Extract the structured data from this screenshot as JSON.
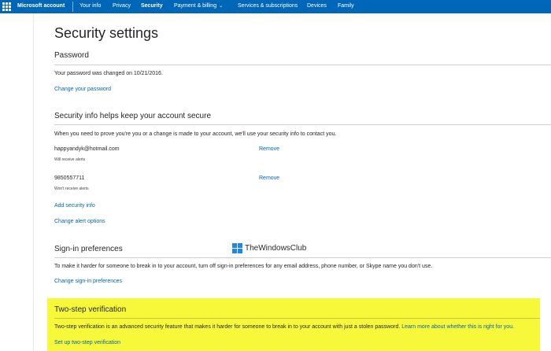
{
  "header": {
    "brand": "Microsoft account",
    "nav": [
      {
        "label": "Your info"
      },
      {
        "label": "Privacy"
      },
      {
        "label": "Security"
      },
      {
        "label": "Payment & billing"
      },
      {
        "label": "Services & subscriptions"
      },
      {
        "label": "Devices"
      },
      {
        "label": "Family"
      }
    ],
    "active_tab": "Security",
    "accent_color": "#0067b8"
  },
  "page": {
    "title": "Security settings"
  },
  "password": {
    "heading": "Password",
    "changed_text": "Your password was changed on 10/21/2016.",
    "change_link": "Change your password"
  },
  "security_info": {
    "heading": "Security info helps keep your account secure",
    "description": "When you need to prove you're you or a change is made to your account, we'll use your security info to contact you.",
    "items": [
      {
        "value": "happyandyk@hotmail.com",
        "note": "Will receive alerts",
        "action": "Remove"
      },
      {
        "value": "9850557711",
        "note": "Won't receive alerts",
        "action": "Remove"
      }
    ],
    "add_link": "Add security info",
    "alert_link": "Change alert options"
  },
  "sign_in": {
    "heading": "Sign-in preferences",
    "description": "To make it harder for someone to break in to your account, turn off sign-in preferences for any email address, phone number, or Skype name you don't use.",
    "change_link": "Change sign-in preferences"
  },
  "two_step": {
    "heading": "Two-step verification",
    "description": "Two-step verification is an advanced security feature that makes it harder for someone to break in to your account with just a stolen password.",
    "learn_link": "Learn more about whether this is right for you.",
    "setup_link": "Set up two-step verification",
    "highlight_color": "#f8f83a"
  },
  "watermark": {
    "text": "TheWindowsClub",
    "logo_colors": [
      "#1e88e5",
      "#1e88e5",
      "#1e88e5",
      "#1e88e5"
    ]
  }
}
